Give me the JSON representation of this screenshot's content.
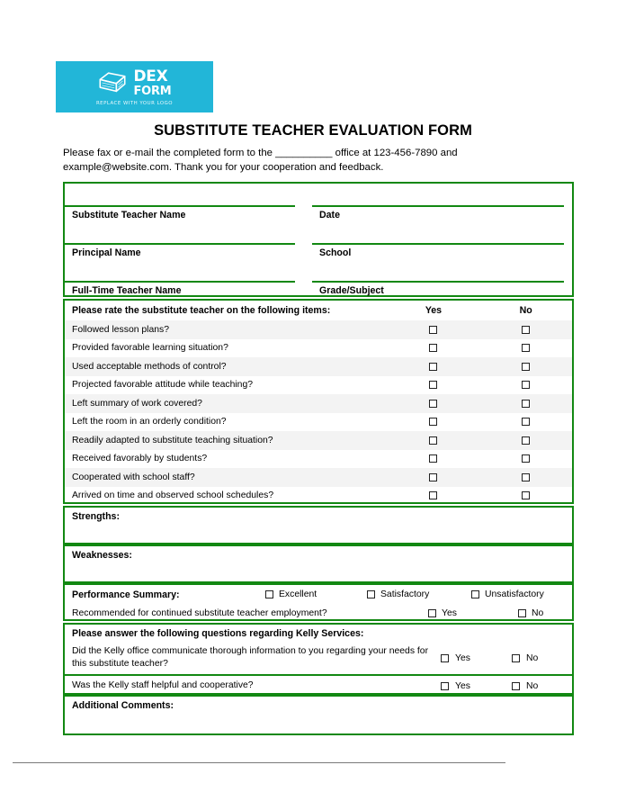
{
  "logo": {
    "brand_top": "DEX",
    "brand_bottom": "FORM",
    "tagline": "REPLACE WITH YOUR LOGO",
    "mark_icon": "stacked-box-icon",
    "background_color": "#22b6d8"
  },
  "document": {
    "title": "SUBSTITUTE TEACHER EVALUATION FORM",
    "intro": "Please fax or e-mail the completed form to the __________ office at 123-456-7890 and example@website.com. Thank you for your cooperation and feedback.",
    "accent_color": "#128812",
    "row_shade_color": "#f3f3f3"
  },
  "identity": {
    "rows": [
      {
        "left_label": "Substitute Teacher Name",
        "right_label": "Date"
      },
      {
        "left_label": "Principal Name",
        "right_label": "School"
      },
      {
        "left_label": "Full-Time Teacher Name",
        "right_label": "Grade/Subject"
      }
    ]
  },
  "rating": {
    "heading": "Please rate the substitute teacher on the following items:",
    "col_yes": "Yes",
    "col_no": "No",
    "items": [
      "Followed lesson plans?",
      "Provided favorable learning situation?",
      "Used acceptable methods of control?",
      "Projected favorable attitude while teaching?",
      "Left summary of work covered?",
      "Left the room in an orderly condition?",
      "Readily adapted to substitute teaching situation?",
      "Received favorably by students?",
      "Cooperated with school staff?",
      "Arrived on time and observed school schedules?"
    ]
  },
  "strengths": {
    "label": "Strengths:"
  },
  "weaknesses": {
    "label": "Weaknesses:"
  },
  "performance": {
    "title": "Performance Summary:",
    "option_excellent": "Excellent",
    "option_satisfactory": "Satisfactory",
    "option_unsatisfactory": "Unsatisfactory",
    "recommend_question": "Recommended for continued substitute teacher employment?",
    "recommend_yes": "Yes",
    "recommend_no": "No"
  },
  "kelly": {
    "heading": "Please answer the following questions regarding Kelly Services:",
    "questions": [
      {
        "text": "Did the Kelly office communicate thorough information to you regarding your needs for this substitute teacher?",
        "yes": "Yes",
        "no": "No"
      },
      {
        "text": "Was the Kelly staff helpful and cooperative?",
        "yes": "Yes",
        "no": "No"
      }
    ]
  },
  "comments": {
    "label": "Additional Comments:"
  }
}
